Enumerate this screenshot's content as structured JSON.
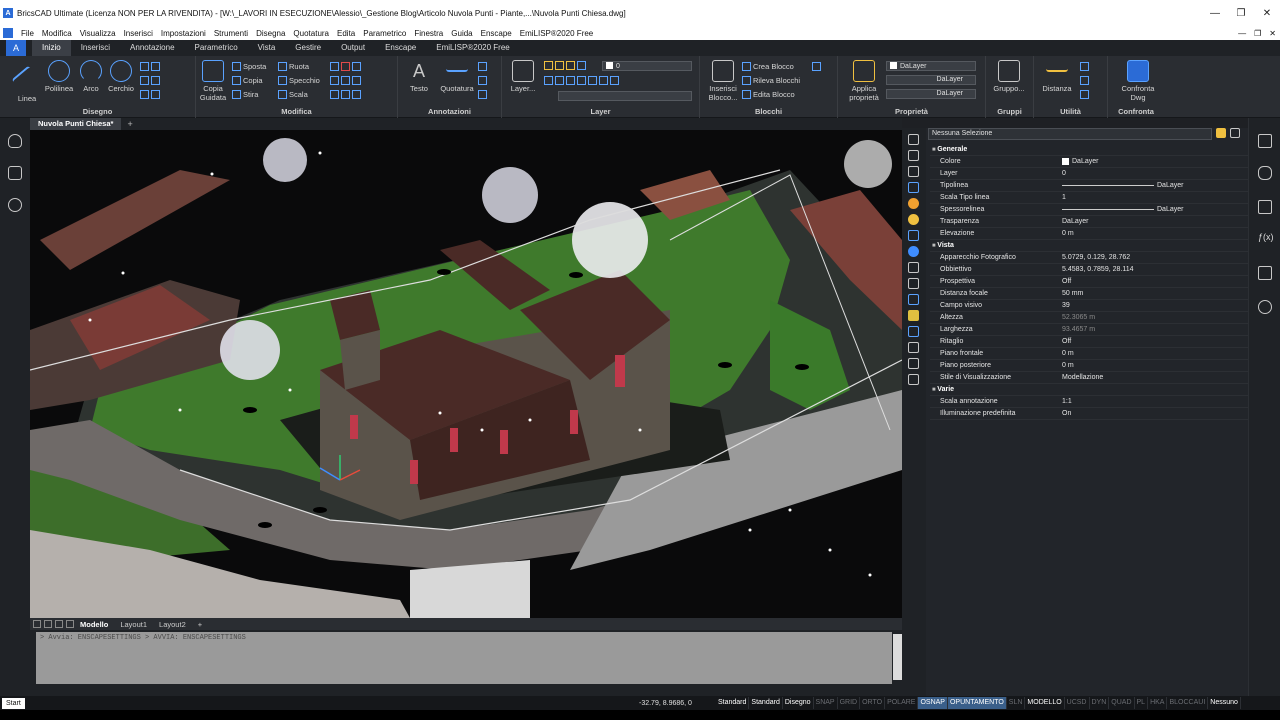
{
  "window": {
    "title": "BricsCAD Ultimate (Licenza NON PER LA RIVENDITA) - [W:\\_LAVORI IN ESECUZIONE\\Alessio\\_Gestione Blog\\Articolo Nuvola Punti - Piante,...\\Nuvola Punti Chiesa.dwg]",
    "minimize": "—",
    "restore": "❐",
    "close": "✕"
  },
  "menubar": {
    "items": [
      "File",
      "Modifica",
      "Visualizza",
      "Inserisci",
      "Impostazioni",
      "Strumenti",
      "Disegna",
      "Quotatura",
      "Edita",
      "Parametrico",
      "Finestra",
      "Guida",
      "Enscape",
      "EmiLISP®2020 Free"
    ],
    "right_min": "—",
    "right_restore": "❐",
    "right_close": "✕"
  },
  "ribbon_tabs": [
    "Inizio",
    "Inserisci",
    "Annotazione",
    "Parametrico",
    "Vista",
    "Gestire",
    "Output",
    "Enscape",
    "EmiLISP®2020 Free"
  ],
  "ribbon": {
    "disegno": {
      "label": "Disegno",
      "buttons": [
        "Linea",
        "Polilinea",
        "Arco",
        "Cerchio"
      ]
    },
    "modifica": {
      "label": "Modifica",
      "copia_guidata": "Copia Guidata",
      "sposta": "Sposta",
      "copia": "Copia",
      "stira": "Stira",
      "ruota": "Ruota",
      "specchio": "Specchio",
      "scala": "Scala"
    },
    "annotazioni": {
      "label": "Annotazioni",
      "testo": "Testo",
      "quotatura": "Quotatura"
    },
    "layer": {
      "label": "Layer",
      "button": "Layer...",
      "current": "0"
    },
    "blocchi": {
      "label": "Blocchi",
      "inserisci": "Inserisci Blocco...",
      "crea": "Crea Blocco",
      "rileva": "Rileva Blocchi",
      "edita": "Edita Blocco"
    },
    "proprieta": {
      "label": "Proprietà",
      "applica": "Applica proprietà",
      "color": "DaLayer",
      "linetype": "DaLayer",
      "lineweight": "DaLayer"
    },
    "gruppi": {
      "label": "Gruppi",
      "button": "Gruppo..."
    },
    "utilita": {
      "label": "Utilità",
      "button": "Distanza"
    },
    "confronta": {
      "label": "Confronta",
      "button": "Confronta Dwg"
    }
  },
  "doc_tab": {
    "name": "Nuvola Punti Chiesa*",
    "add": "+"
  },
  "model_tabs": [
    "Modello",
    "Layout1",
    "Layout2",
    "+"
  ],
  "command_line": {
    "history": "> Avvia: ENSCAPESETTINGS    > AVVIA: ENSCAPESETTINGS"
  },
  "properties": {
    "selection": "Nessuna Selezione",
    "sections": [
      {
        "title": "Generale",
        "rows": [
          {
            "k": "Colore",
            "v": "DaLayer",
            "type": "swatch"
          },
          {
            "k": "Layer",
            "v": "0"
          },
          {
            "k": "Tipolinea",
            "v": "DaLayer",
            "type": "line"
          },
          {
            "k": "Scala Tipo linea",
            "v": "1"
          },
          {
            "k": "Spessorelinea",
            "v": "DaLayer",
            "type": "line"
          },
          {
            "k": "Trasparenza",
            "v": "DaLayer"
          },
          {
            "k": "Elevazione",
            "v": "0 m"
          }
        ]
      },
      {
        "title": "Vista",
        "rows": [
          {
            "k": "Apparecchio Fotografico",
            "v": "5.0729, 0.129, 28.762"
          },
          {
            "k": "Obbiettivo",
            "v": "5.4583, 0.7859, 28.114"
          },
          {
            "k": "Prospettiva",
            "v": "Off"
          },
          {
            "k": "Distanza focale",
            "v": "50 mm"
          },
          {
            "k": "Campo visivo",
            "v": "39"
          },
          {
            "k": "Altezza",
            "v": "52.3065 m",
            "type": "dim"
          },
          {
            "k": "Larghezza",
            "v": "93.4657 m",
            "type": "dim"
          },
          {
            "k": "Ritaglio",
            "v": "Off"
          },
          {
            "k": "Piano frontale",
            "v": "0 m"
          },
          {
            "k": "Piano posteriore",
            "v": "0 m"
          },
          {
            "k": "Stile di Visualizzazione",
            "v": "Modellazione"
          }
        ]
      },
      {
        "title": "Varie",
        "rows": [
          {
            "k": "Scala annotazione",
            "v": "1:1"
          },
          {
            "k": "Illuminazione predefinita",
            "v": "On"
          }
        ]
      }
    ]
  },
  "statusbar": {
    "start": "Start",
    "coords": "-32.79, 8.9686, 0",
    "items": [
      {
        "t": "Standard",
        "s": "on"
      },
      {
        "t": "Standard",
        "s": "on"
      },
      {
        "t": "Disegno",
        "s": "on"
      },
      {
        "t": "SNAP",
        "s": "off"
      },
      {
        "t": "GRID",
        "s": "off"
      },
      {
        "t": "ORTO",
        "s": "off"
      },
      {
        "t": "POLARE",
        "s": "off"
      },
      {
        "t": "OSNAP",
        "s": "hl"
      },
      {
        "t": "OPUNTAMENTO",
        "s": "hl"
      },
      {
        "t": "SLN",
        "s": "off"
      },
      {
        "t": "MODELLO",
        "s": "on"
      },
      {
        "t": "UCSD",
        "s": "off"
      },
      {
        "t": "DYN",
        "s": "off"
      },
      {
        "t": "QUAD",
        "s": "off"
      },
      {
        "t": "PL",
        "s": "off"
      },
      {
        "t": "HKA",
        "s": "off"
      },
      {
        "t": "BLOCCAUI",
        "s": "off"
      },
      {
        "t": "Nessuno",
        "s": "on"
      }
    ]
  },
  "colors": {
    "accent": "#2b6bd6",
    "ribbon": "#2a2d32",
    "roof": "#4a2a26",
    "grass": "#3f7a2c"
  }
}
